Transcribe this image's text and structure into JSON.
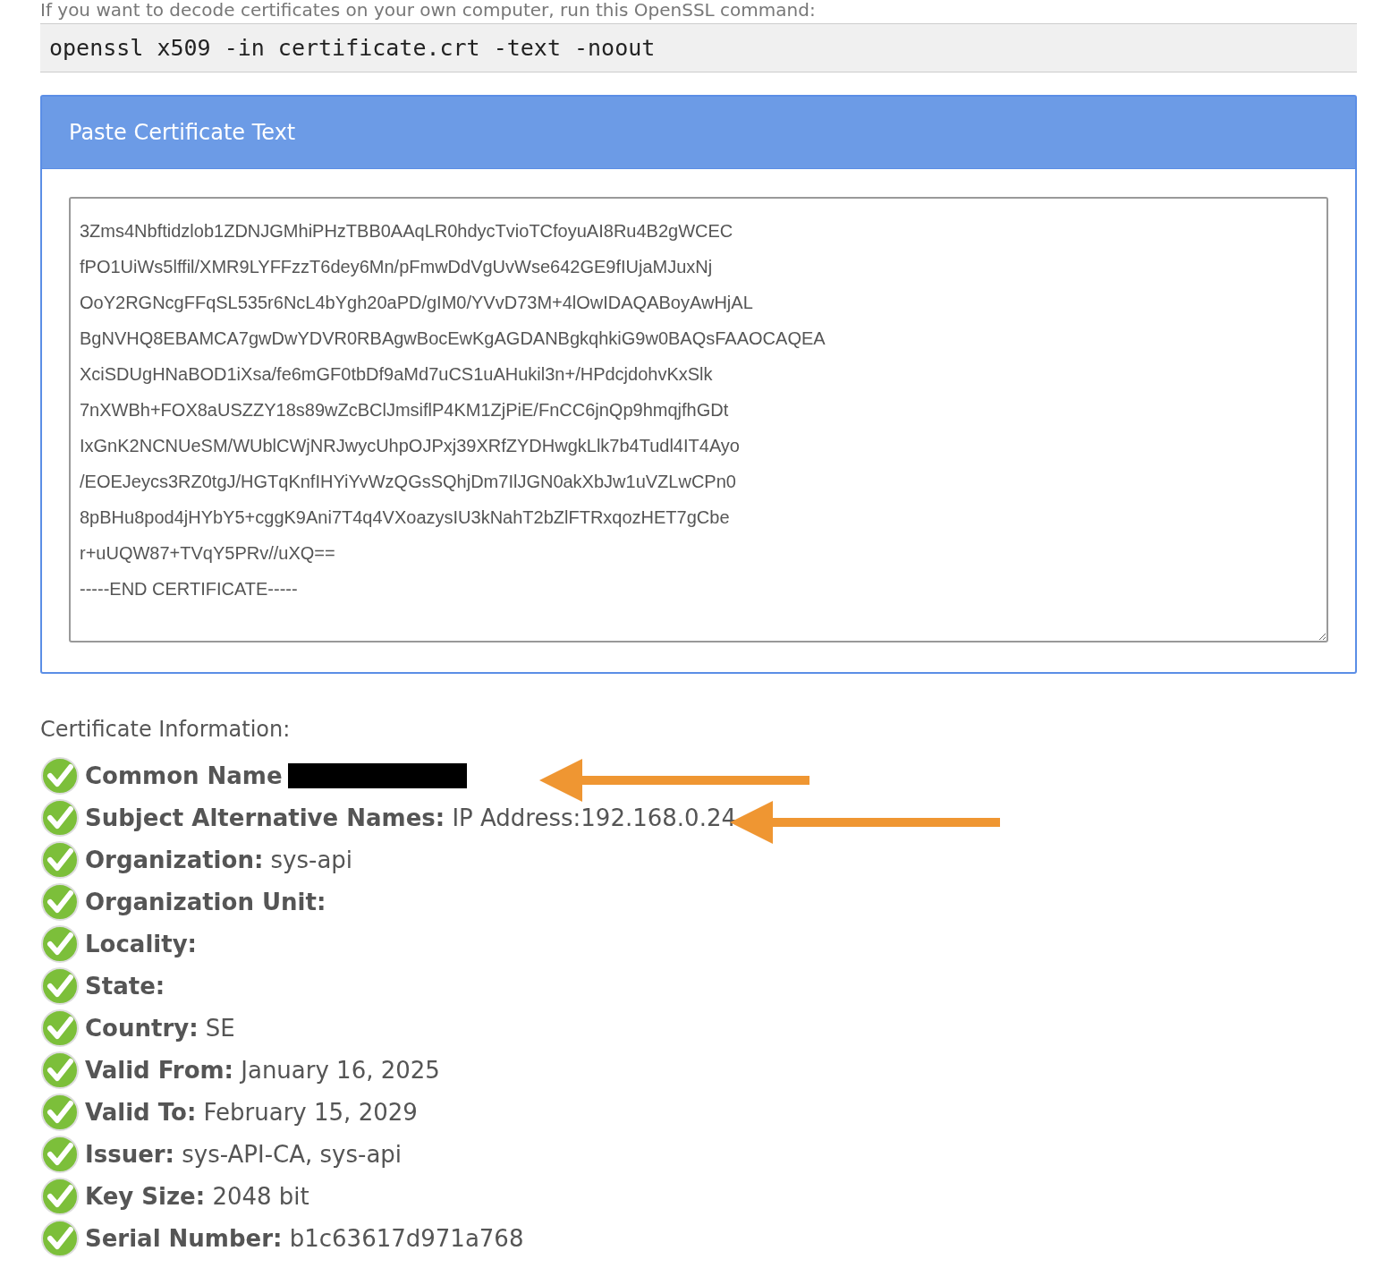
{
  "intro": "If you want to decode certificates on your own computer, run this OpenSSL command:",
  "command": "openssl x509 -in certificate.crt -text -noout",
  "panel": {
    "title": "Paste Certificate Text",
    "certificate_lines": [
      "3Zms4Nbftidzlob1ZDNJGMhiPHzTBB0AAqLR0hdycTvioTCfoyuAI8Ru4B2gWCEC",
      "fPO1UiWs5lffil/XMR9LYFFzzT6dey6Mn/pFmwDdVgUvWse642GE9fIUjaMJuxNj",
      "OoY2RGNcgFFqSL535r6NcL4bYgh20aPD/gIM0/YVvD73M+4lOwIDAQABoyAwHjAL",
      "BgNVHQ8EBAMCA7gwDwYDVR0RBAgwBocEwKgAGDANBgkqhkiG9w0BAQsFAAOCAQEA",
      "XciSDUgHNaBOD1iXsa/fe6mGF0tbDf9aMd7uCS1uAHukil3n+/HPdcjdohvKxSlk",
      "7nXWBh+FOX8aUSZZY18s89wZcBClJmsiflP4KM1ZjPiE/FnCC6jnQp9hmqjfhGDt",
      "IxGnK2NCNUeSM/WUblCWjNRJwycUhpOJPxj39XRfZYDHwgkLlk7b4Tudl4IT4Ayo",
      "/EOEJeycs3RZ0tgJ/HGTqKnfIHYiYvWzQGsSQhjDm7IlJGN0akXbJw1uVZLwCPn0",
      "8pBHu8pod4jHYbY5+cggK9Ani7T4q4VXoazysIU3kNahT2bZlFTRxqozHET7gCbe",
      "r+uUQW87+TVqY5PRv//uXQ==",
      "-----END CERTIFICATE-----"
    ]
  },
  "info": {
    "heading": "Certificate Information:",
    "items": [
      {
        "label": "Common Name",
        "valid": true,
        "redacted": true,
        "arrow": true
      },
      {
        "label": "Subject Alternative Names:",
        "value": "IP Address:192.168.0.24",
        "valid": true,
        "redacted": false,
        "arrow": true
      },
      {
        "label": "Organization:",
        "value": "sys-api",
        "valid": true,
        "redacted": false,
        "arrow": false
      },
      {
        "label": "Organization Unit:",
        "valid": true,
        "redacted": false,
        "arrow": false
      },
      {
        "label": "Locality:",
        "valid": true,
        "redacted": false,
        "arrow": false
      },
      {
        "label": "State:",
        "valid": true,
        "redacted": false,
        "arrow": false
      },
      {
        "label": "Country:",
        "value": "SE",
        "valid": true,
        "redacted": false,
        "arrow": false
      },
      {
        "label": "Valid From:",
        "value": "January 16, 2025",
        "valid": true,
        "redacted": false,
        "arrow": false
      },
      {
        "label": "Valid To:",
        "value": "February 15, 2029",
        "valid": true,
        "redacted": false,
        "arrow": false
      },
      {
        "label": "Issuer:",
        "value": "sys-API-CA, sys-api",
        "valid": true,
        "redacted": false,
        "arrow": false
      },
      {
        "label": "Key Size:",
        "value": "2048 bit",
        "valid": true,
        "redacted": false,
        "arrow": false
      },
      {
        "label": "Serial Number:",
        "value": "b1c63617d971a768",
        "valid": true,
        "redacted": false,
        "arrow": false
      }
    ]
  }
}
